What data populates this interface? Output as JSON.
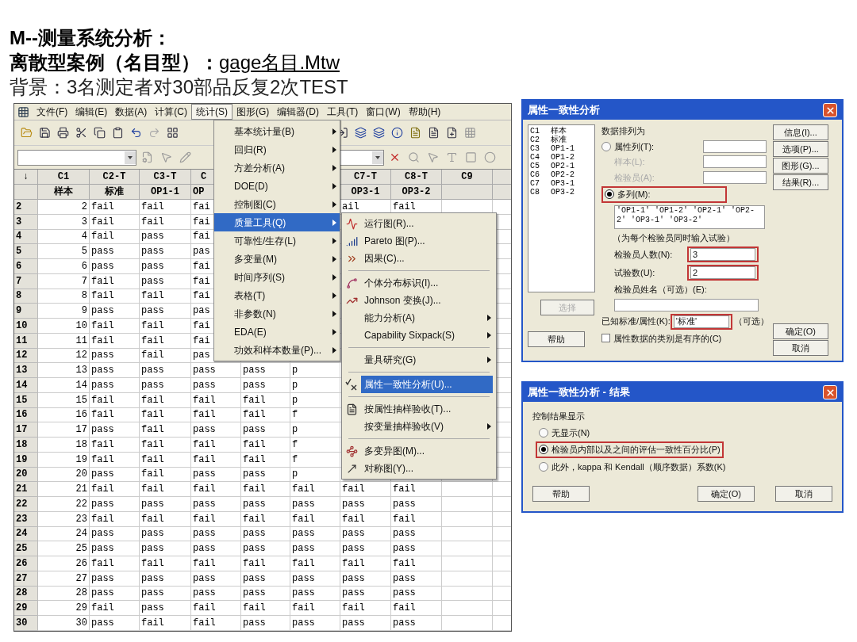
{
  "slide": {
    "title": "M--测量系统分析：",
    "subtitle": "离散型案例（名目型）：",
    "file_link": "gage名目.Mtw",
    "background": "背景：3名测定者对30部品反复2次TEST"
  },
  "minitab": {
    "menu_bar": [
      {
        "label": "文件(F)",
        "selected": false
      },
      {
        "label": "编辑(E)",
        "selected": false
      },
      {
        "label": "数据(A)",
        "selected": false
      },
      {
        "label": "计算(C)",
        "selected": false
      },
      {
        "label": "统计(S)",
        "selected": true
      },
      {
        "label": "图形(G)",
        "selected": false
      },
      {
        "label": "编辑器(D)",
        "selected": false
      },
      {
        "label": "工具(T)",
        "selected": false
      },
      {
        "label": "窗口(W)",
        "selected": false
      },
      {
        "label": "帮助(H)",
        "selected": false
      }
    ],
    "worksheet": {
      "corner": "↓",
      "columns": [
        {
          "id": "C1",
          "name": "样本"
        },
        {
          "id": "C2-T",
          "name": "标准"
        },
        {
          "id": "C3-T",
          "name": "OP1-1"
        },
        {
          "id": "C",
          "name": "OP"
        },
        null,
        null,
        {
          "id": "C7-T",
          "name": "OP3-1"
        },
        {
          "id": "C8-T",
          "name": "OP3-2"
        },
        {
          "id": "C9"
        }
      ],
      "rows": [
        {
          "label": "2",
          "cells": [
            "2",
            "fail",
            "fail",
            "fai",
            null,
            null,
            "ail",
            "fail"
          ]
        },
        {
          "label": "3",
          "cells": [
            "3",
            "fail",
            "fail",
            "fai",
            null,
            null,
            null,
            null
          ]
        },
        {
          "label": "4",
          "cells": [
            "4",
            "fail",
            "pass",
            "fai",
            null,
            null,
            null,
            null
          ]
        },
        {
          "label": "5",
          "cells": [
            "5",
            "pass",
            "pass",
            "pas",
            null,
            null,
            null,
            null
          ]
        },
        {
          "label": "6",
          "cells": [
            "6",
            "pass",
            "pass",
            "fai",
            null,
            null,
            null,
            null
          ]
        },
        {
          "label": "7",
          "cells": [
            "7",
            "fail",
            "pass",
            "fai",
            null,
            null,
            null,
            null
          ]
        },
        {
          "label": "8",
          "cells": [
            "8",
            "fail",
            "fail",
            "fai",
            null,
            null,
            null,
            null
          ]
        },
        {
          "label": "9",
          "cells": [
            "9",
            "pass",
            "pass",
            "pas",
            null,
            null,
            null,
            null
          ]
        },
        {
          "label": "10",
          "cells": [
            "10",
            "fail",
            "fail",
            "fai",
            null,
            null,
            null,
            null
          ]
        },
        {
          "label": "11",
          "cells": [
            "11",
            "fail",
            "fail",
            "fai",
            null,
            null,
            null,
            null
          ]
        },
        {
          "label": "12",
          "cells": [
            "12",
            "pass",
            "fail",
            "pas",
            null,
            null,
            null,
            null
          ]
        },
        {
          "label": "13",
          "cells": [
            "13",
            "pass",
            "pass",
            "pass",
            "pass",
            "p",
            null,
            null
          ]
        },
        {
          "label": "14",
          "cells": [
            "14",
            "pass",
            "pass",
            "pass",
            "pass",
            "p",
            null,
            null
          ]
        },
        {
          "label": "15",
          "cells": [
            "15",
            "fail",
            "fail",
            "fail",
            "fail",
            "p",
            null,
            null
          ]
        },
        {
          "label": "16",
          "cells": [
            "16",
            "fail",
            "fail",
            "fail",
            "fail",
            "f",
            null,
            null
          ]
        },
        {
          "label": "17",
          "cells": [
            "17",
            "pass",
            "fail",
            "pass",
            "pass",
            "p",
            null,
            null
          ]
        },
        {
          "label": "18",
          "cells": [
            "18",
            "fail",
            "fail",
            "fail",
            "fail",
            "f",
            null,
            null
          ]
        },
        {
          "label": "19",
          "cells": [
            "19",
            "fail",
            "fail",
            "fail",
            "fail",
            "f",
            null,
            null
          ]
        },
        {
          "label": "20",
          "cells": [
            "20",
            "pass",
            "fail",
            "pass",
            "pass",
            "p",
            null,
            null
          ]
        },
        {
          "label": "21",
          "cells": [
            "21",
            "fail",
            "fail",
            "fail",
            "fail",
            "fail",
            "fail",
            "fail"
          ]
        },
        {
          "label": "22",
          "cells": [
            "22",
            "pass",
            "pass",
            "pass",
            "pass",
            "pass",
            "pass",
            "pass"
          ]
        },
        {
          "label": "23",
          "cells": [
            "23",
            "fail",
            "fail",
            "fail",
            "fail",
            "fail",
            "fail",
            "fail"
          ]
        },
        {
          "label": "24",
          "cells": [
            "24",
            "pass",
            "pass",
            "pass",
            "pass",
            "pass",
            "pass",
            "pass"
          ]
        },
        {
          "label": "25",
          "cells": [
            "25",
            "pass",
            "pass",
            "pass",
            "pass",
            "pass",
            "pass",
            "pass"
          ]
        },
        {
          "label": "26",
          "cells": [
            "26",
            "fail",
            "fail",
            "fail",
            "fail",
            "fail",
            "fail",
            "fail"
          ]
        },
        {
          "label": "27",
          "cells": [
            "27",
            "pass",
            "pass",
            "pass",
            "pass",
            "pass",
            "pass",
            "pass"
          ]
        },
        {
          "label": "28",
          "cells": [
            "28",
            "pass",
            "pass",
            "pass",
            "pass",
            "pass",
            "pass",
            "pass"
          ]
        },
        {
          "label": "29",
          "cells": [
            "29",
            "fail",
            "pass",
            "fail",
            "fail",
            "fail",
            "fail",
            "fail"
          ]
        },
        {
          "label": "30",
          "cells": [
            "30",
            "pass",
            "fail",
            "fail",
            "pass",
            "pass",
            "pass",
            "pass"
          ]
        }
      ]
    },
    "stat_menu": [
      {
        "label": "基本统计量(B)",
        "submenu": true,
        "selected": false
      },
      {
        "label": "回归(R)",
        "submenu": true,
        "selected": false
      },
      {
        "label": "方差分析(A)",
        "submenu": true,
        "selected": false
      },
      {
        "label": "DOE(D)",
        "submenu": true,
        "selected": false
      },
      {
        "label": "控制图(C)",
        "submenu": true,
        "selected": false
      },
      {
        "label": "质量工具(Q)",
        "submenu": true,
        "selected": true
      },
      {
        "label": "可靠性/生存(L)",
        "submenu": true,
        "selected": false
      },
      {
        "label": "多变量(M)",
        "submenu": true,
        "selected": false
      },
      {
        "label": "时间序列(S)",
        "submenu": true,
        "selected": false
      },
      {
        "label": "表格(T)",
        "submenu": true,
        "selected": false
      },
      {
        "label": "非参数(N)",
        "submenu": true,
        "selected": false
      },
      {
        "label": "EDA(E)",
        "submenu": true,
        "selected": false
      },
      {
        "label": "功效和样本数量(P)...",
        "submenu": true,
        "selected": false
      }
    ],
    "quality_submenu": [
      {
        "kind": "item",
        "label": "运行图(R)...",
        "submenu": false,
        "selected": false
      },
      {
        "kind": "item",
        "label": "Pareto 图(P)...",
        "submenu": false,
        "selected": false
      },
      {
        "kind": "item",
        "label": "因果(C)...",
        "submenu": false,
        "selected": false
      },
      {
        "kind": "separator"
      },
      {
        "kind": "item",
        "label": "个体分布标识(I)...",
        "submenu": false,
        "selected": false
      },
      {
        "kind": "item",
        "label": "Johnson 变换(J)...",
        "submenu": false,
        "selected": false
      },
      {
        "kind": "item",
        "label": "能力分析(A)",
        "submenu": true,
        "selected": false
      },
      {
        "kind": "item",
        "label": "Capability Sixpack(S)",
        "submenu": true,
        "selected": false
      },
      {
        "kind": "separator"
      },
      {
        "kind": "item",
        "label": "量具研究(G)",
        "submenu": true,
        "selected": false
      },
      {
        "kind": "separator"
      },
      {
        "kind": "item",
        "label": "属性一致性分析(U)...",
        "submenu": false,
        "selected": true
      },
      {
        "kind": "separator"
      },
      {
        "kind": "item",
        "label": "按属性抽样验收(T)...",
        "submenu": false,
        "selected": false
      },
      {
        "kind": "item",
        "label": "按变量抽样验收(V)",
        "submenu": true,
        "selected": false
      },
      {
        "kind": "separator"
      },
      {
        "kind": "item",
        "label": "多变异图(M)...",
        "submenu": false,
        "selected": false
      },
      {
        "kind": "item",
        "label": "对称图(Y)...",
        "submenu": false,
        "selected": false
      }
    ]
  },
  "attribute_dialog": {
    "title": "属性一致性分析",
    "column_list": [
      {
        "id": "C1",
        "name": "样本"
      },
      {
        "id": "C2",
        "name": "标准"
      },
      {
        "id": "C3",
        "name": "OP1-1"
      },
      {
        "id": "C4",
        "name": "OP1-2"
      },
      {
        "id": "C5",
        "name": "OP2-1"
      },
      {
        "id": "C6",
        "name": "OP2-2"
      },
      {
        "id": "C7",
        "name": "OP3-1"
      },
      {
        "id": "C8",
        "name": "OP3-2"
      }
    ],
    "arrangement_label": "数据排列为",
    "attribute_column": {
      "label": "属性列(T):",
      "selected": false
    },
    "sample": {
      "label": "样本(L):",
      "disabled": true
    },
    "appraiser": {
      "label": "检验员(A):",
      "disabled": true
    },
    "multiple_columns": {
      "label": "多列(M):",
      "selected": true,
      "highlighted": true,
      "value": "'OP1-1' 'OP1-2' 'OP2-1' 'OP2-2' 'OP3-1' 'OP3-2'"
    },
    "note": "（为每个检验员同时输入试验）",
    "appraiser_count": {
      "label": "检验员人数(N):",
      "value": "3",
      "highlighted": true
    },
    "trial_count": {
      "label": "试验数(U):",
      "value": "2",
      "highlighted": true
    },
    "appraiser_names": {
      "label": "检验员姓名（可选）(E):"
    },
    "known_standard": {
      "label": "已知标准/属性(K):",
      "value": "'标准'",
      "highlighted": true,
      "hint": "（可选）"
    },
    "ordered": {
      "label": "属性数据的类别是有序的(C)",
      "checked": false
    },
    "side_buttons": [
      "信息(I)...",
      "选项(P)...",
      "图形(G)...",
      "结果(R)..."
    ],
    "select_button": {
      "label": "选择",
      "disabled": true
    },
    "help_button": "帮助",
    "ok_button": "确定(O)",
    "cancel_button": "取消"
  },
  "results_dialog": {
    "title": "属性一致性分析 - 结果",
    "group_label": "控制结果显示",
    "options": [
      {
        "label": "无显示(N)",
        "selected": false,
        "highlighted": false
      },
      {
        "label": "检验员内部以及之间的评估一致性百分比(P)",
        "selected": true,
        "highlighted": true
      },
      {
        "label": "此外，kappa 和 Kendall（顺序数据）系数(K)",
        "selected": false,
        "highlighted": false
      }
    ],
    "help_button": "帮助",
    "ok_button": "确定(O)",
    "cancel_button": "取消"
  }
}
